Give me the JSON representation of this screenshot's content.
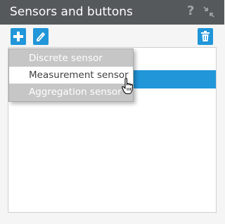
{
  "window": {
    "title": "Sensors and buttons",
    "help_label": "?",
    "help_icon": "question-mark-icon",
    "shrink_icon": "collapse-arrows-icon"
  },
  "toolbar": {
    "add_icon": "plus-icon",
    "edit_icon": "pencil-icon",
    "delete_icon": "trash-icon",
    "accent_color": "#2196d9"
  },
  "menu": {
    "items": [
      {
        "label": "Discrete sensor",
        "hovered": false
      },
      {
        "label": "Measurement sensor",
        "hovered": true
      },
      {
        "label": "Aggregation sensor",
        "hovered": false
      }
    ]
  },
  "list": {
    "selected_row_color": "#2196d9"
  }
}
